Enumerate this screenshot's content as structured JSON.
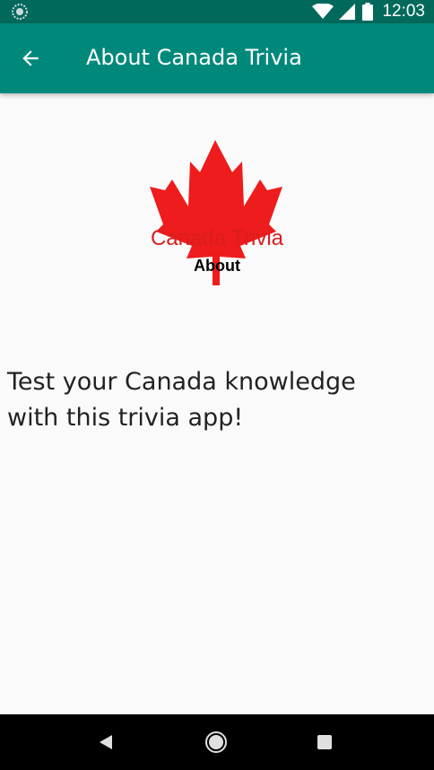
{
  "status_bar": {
    "time": "12:03",
    "left_icon": "spinner-icon",
    "icons": [
      "wifi-icon",
      "cellular-signal-icon",
      "battery-icon"
    ]
  },
  "app_bar": {
    "title": "About Canada Trivia",
    "back_icon": "arrow-left-icon",
    "background_color": "#00897b",
    "status_color": "#00695c"
  },
  "logo": {
    "title": "Canada Trivia",
    "subtitle": "About",
    "leaf_color": "#ee1c1c",
    "icon": "maple-leaf-icon"
  },
  "content": {
    "description": "Test your Canada knowledge with this trivia app!"
  },
  "nav_bar": {
    "buttons": [
      "back-triangle-icon",
      "home-circle-icon",
      "recents-square-icon"
    ]
  }
}
